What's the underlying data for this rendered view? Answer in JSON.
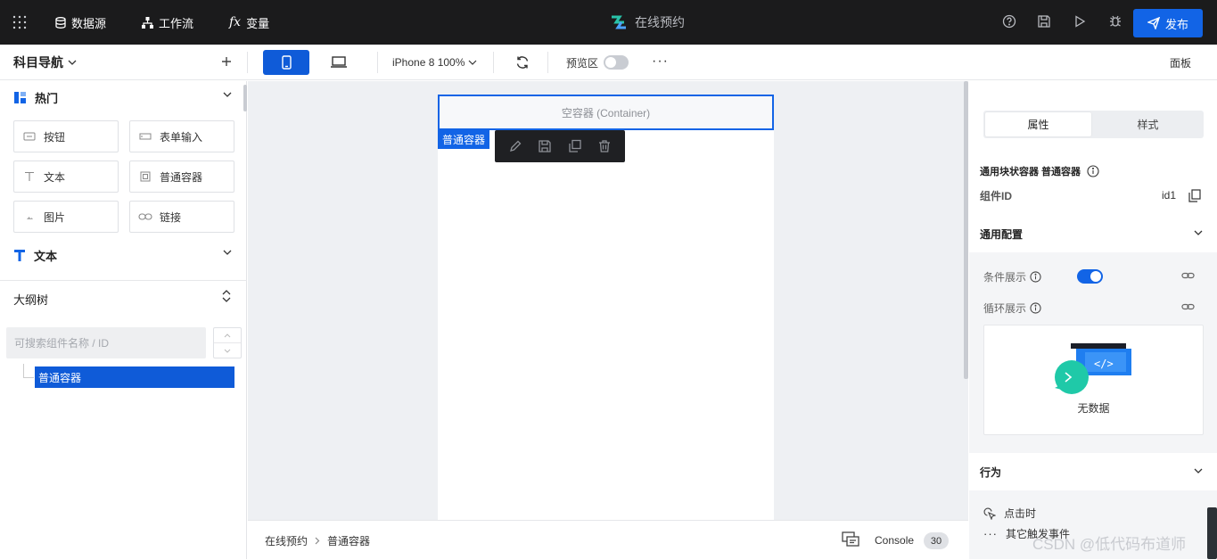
{
  "topbar": {
    "datasource": "数据源",
    "workflow": "工作流",
    "variables": "变量",
    "app_title": "在线预约",
    "publish": "发布"
  },
  "toolbar": {
    "nav_title": "科目导航",
    "device": "iPhone 8 100%",
    "preview_label": "预览区",
    "preview_on": false,
    "more": "···",
    "panel": "面板"
  },
  "left": {
    "hot_section": "热门",
    "components": [
      {
        "label": "按钮",
        "icon": "button-icon"
      },
      {
        "label": "表单输入",
        "icon": "input-icon"
      },
      {
        "label": "文本",
        "icon": "text-icon"
      },
      {
        "label": "普通容器",
        "icon": "container-icon"
      },
      {
        "label": "图片",
        "icon": "image-icon"
      },
      {
        "label": "链接",
        "icon": "link-icon"
      }
    ],
    "text_section": "文本",
    "outline_title": "大纲树",
    "search_placeholder": "可搜索组件名称 / ID",
    "tree_node": "普通容器"
  },
  "canvas": {
    "container_label": "空容器 (Container)",
    "selected_tag": "普通容器"
  },
  "bottombar": {
    "crumb_root": "在线预约",
    "crumb_current": "普通容器",
    "console": "Console",
    "console_count": "30"
  },
  "right": {
    "tab_props": "属性",
    "tab_style": "样式",
    "component_type": "通用块状容器 普通容器",
    "id_label": "组件ID",
    "id_value": "id1",
    "general_config": "通用配置",
    "conditional": "条件展示",
    "conditional_on": true,
    "loop": "循环展示",
    "no_data": "无数据",
    "behavior": "行为",
    "on_click": "点击时",
    "other_events": "其它触发事件"
  },
  "watermark": "CSDN @低代码布道师",
  "colors": {
    "accent": "#1264e6",
    "topbar": "#1b1b1c"
  }
}
